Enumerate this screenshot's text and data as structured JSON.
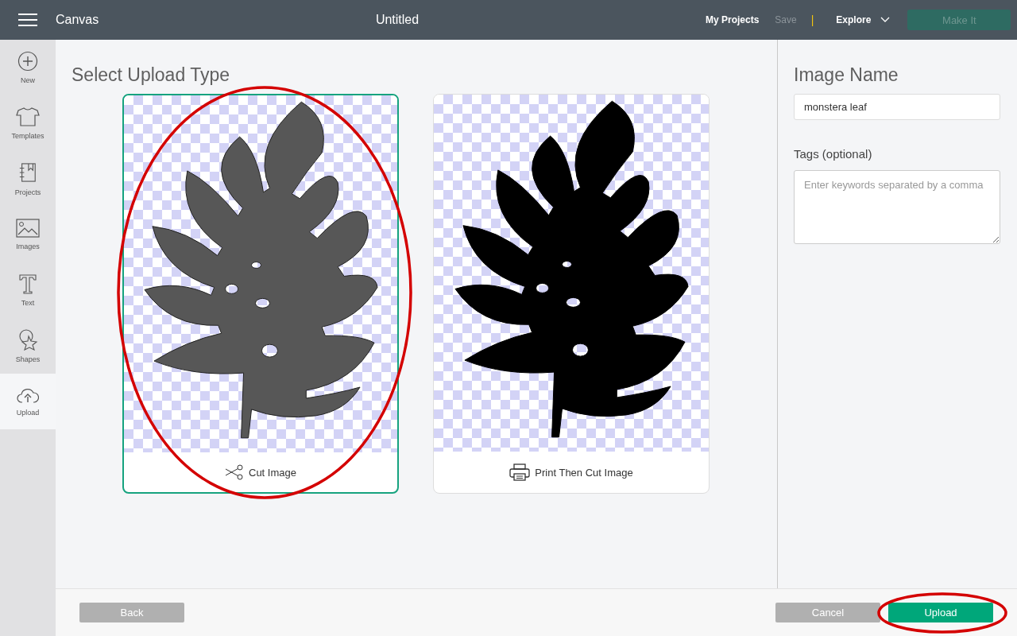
{
  "top_bar": {
    "app_title": "Canvas",
    "document_title": "Untitled",
    "nav": [
      {
        "label": "My Projects",
        "disabled": false
      },
      {
        "label": "Save",
        "disabled": true
      }
    ],
    "separator": "|",
    "explore": "Explore",
    "make_it": {
      "label": "Make It",
      "disabled": true
    }
  },
  "sidebar": {
    "items": [
      {
        "kind": "new",
        "label": "New",
        "selected": false
      },
      {
        "kind": "templates",
        "label": "Templates",
        "selected": false
      },
      {
        "kind": "projects",
        "label": "Projects",
        "selected": false
      },
      {
        "kind": "images",
        "label": "Images",
        "selected": false
      },
      {
        "kind": "text",
        "label": "Text",
        "selected": false
      },
      {
        "kind": "shapes",
        "label": "Shapes",
        "selected": false
      },
      {
        "kind": "upload",
        "label": "Upload",
        "selected": true
      }
    ]
  },
  "heading": "Select Upload Type",
  "upload_types": [
    {
      "kind": "cut",
      "label": "Cut Image",
      "selected": true,
      "circled": true
    },
    {
      "kind": "print",
      "label": "Print Then Cut Image",
      "selected": false,
      "circled": false
    }
  ],
  "form": {
    "name_label": "Image Name",
    "name_value": "monstera leaf",
    "tags_label": "Tags (optional)",
    "tags_placeholder": "Enter keywords separated by a comma"
  },
  "footer": {
    "back": {
      "label": "Back"
    },
    "cancel": {
      "label": "Cancel"
    },
    "upload": {
      "label": "Upload",
      "circled": true
    }
  }
}
